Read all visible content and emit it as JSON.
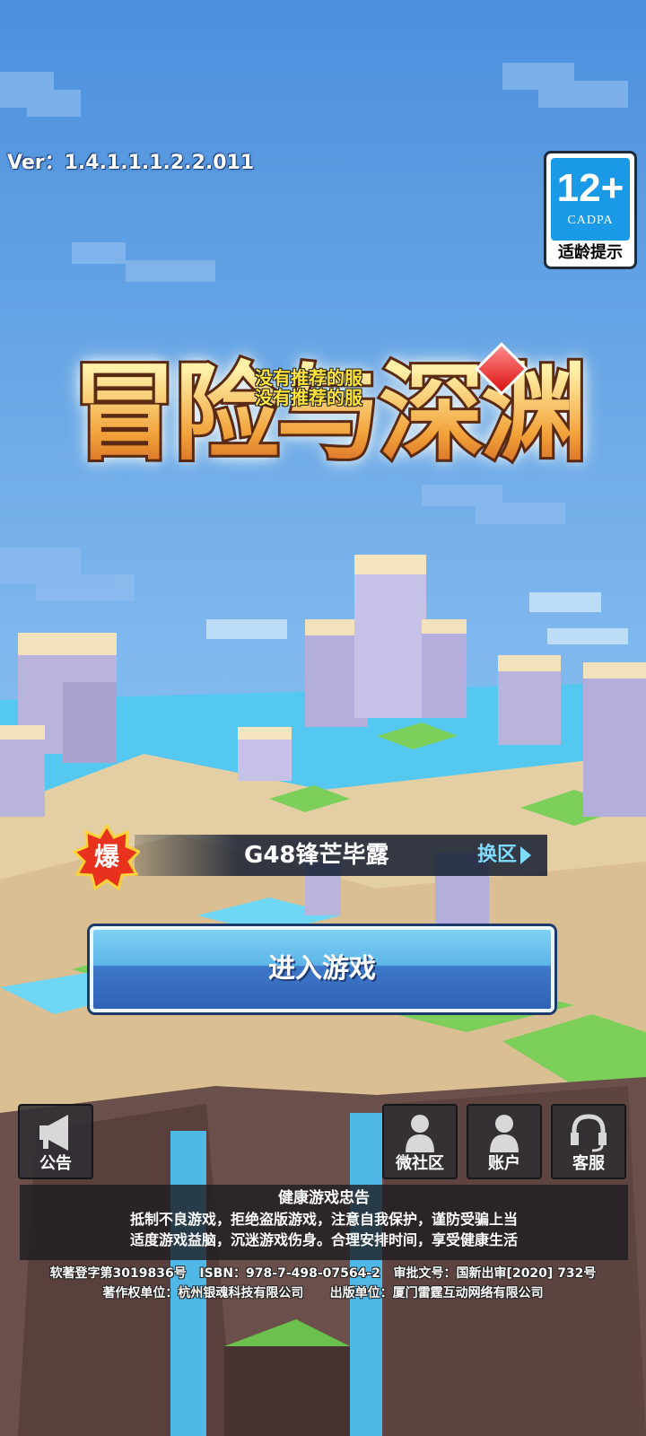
{
  "version": "Ver：1.4.1.1.1.2.2.011",
  "age_rating": {
    "number": "12+",
    "org": "CADPA",
    "label": "适龄提示"
  },
  "logo": {
    "title": "冒险与深渊",
    "subtitle_line1": "没有推荐的服",
    "subtitle_line2": "没有推荐的服"
  },
  "server": {
    "hot_badge": "爆",
    "name": "G48锋芒毕露",
    "switch_label": "换区"
  },
  "enter_button": "进入游戏",
  "menu": {
    "announcement": "公告",
    "community": "微社区",
    "account": "账户",
    "support": "客服"
  },
  "health_notice": {
    "title": "健康游戏忠告",
    "line1": "抵制不良游戏，拒绝盗版游戏，注意自我保护，谨防受骗上当",
    "line2": "适度游戏益脑，沉迷游戏伤身。合理安排时间，享受健康生活"
  },
  "footer": {
    "line1": "软著登字第3019836号   ISBN：978-7-498-07564-2   审批文号：国新出审[2020] 732号",
    "line2": "著作权单位：杭州银魂科技有限公司      出版单位：厦门雷霆互动网络有限公司"
  },
  "colors": {
    "sky_top": "#4f95de",
    "sky_bottom": "#8fc6f2",
    "enter_button": "#3f78c9",
    "switch_text": "#7fdcff",
    "age_badge": "#1a9ae6"
  }
}
